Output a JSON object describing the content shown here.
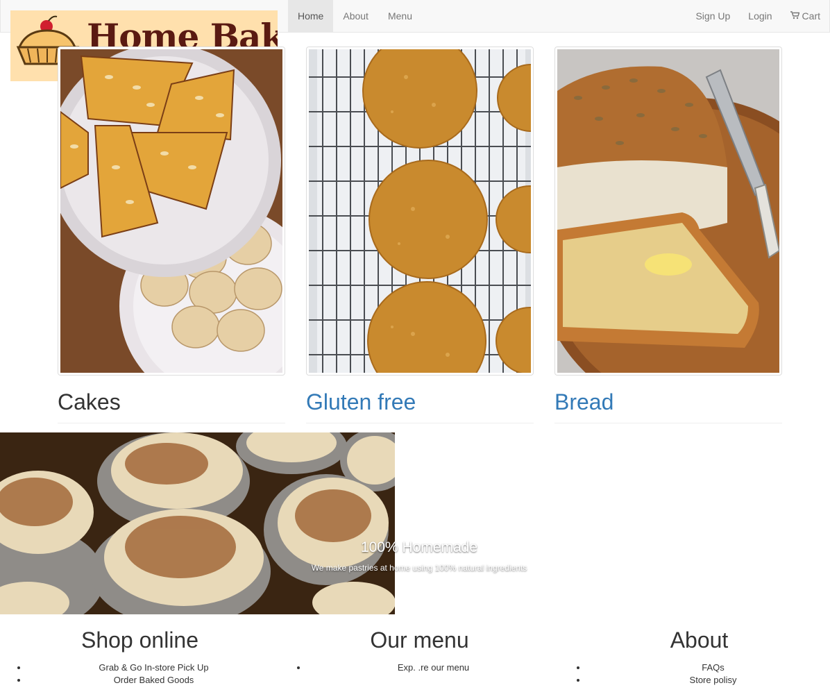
{
  "navbar": {
    "links": [
      "Home",
      "About",
      "Menu"
    ],
    "right_links": [
      "Sign Up",
      "Login",
      "Cart"
    ]
  },
  "logo": {
    "text": "Home Bakery"
  },
  "cards": [
    {
      "title": "Cakes"
    },
    {
      "title": "Gluten free"
    },
    {
      "title": "Bread"
    }
  ],
  "banner": {
    "heading": "100% Homemade",
    "subtext": "We make pastries at home using 100% natural ingredients"
  },
  "footer": {
    "columns": [
      {
        "title": "Shop online",
        "items": [
          "Grab & Go In-store Pick Up",
          "Order Baked Goods"
        ]
      },
      {
        "title": "Our menu",
        "items": [
          "Exp. .re our menu"
        ]
      },
      {
        "title": "About",
        "items": [
          "FAQs",
          "Store polisy"
        ]
      }
    ]
  },
  "colors": {
    "link": "#337ab7",
    "navbar_bg": "#f8f8f8",
    "logo_bg": "#ffe0ad"
  }
}
